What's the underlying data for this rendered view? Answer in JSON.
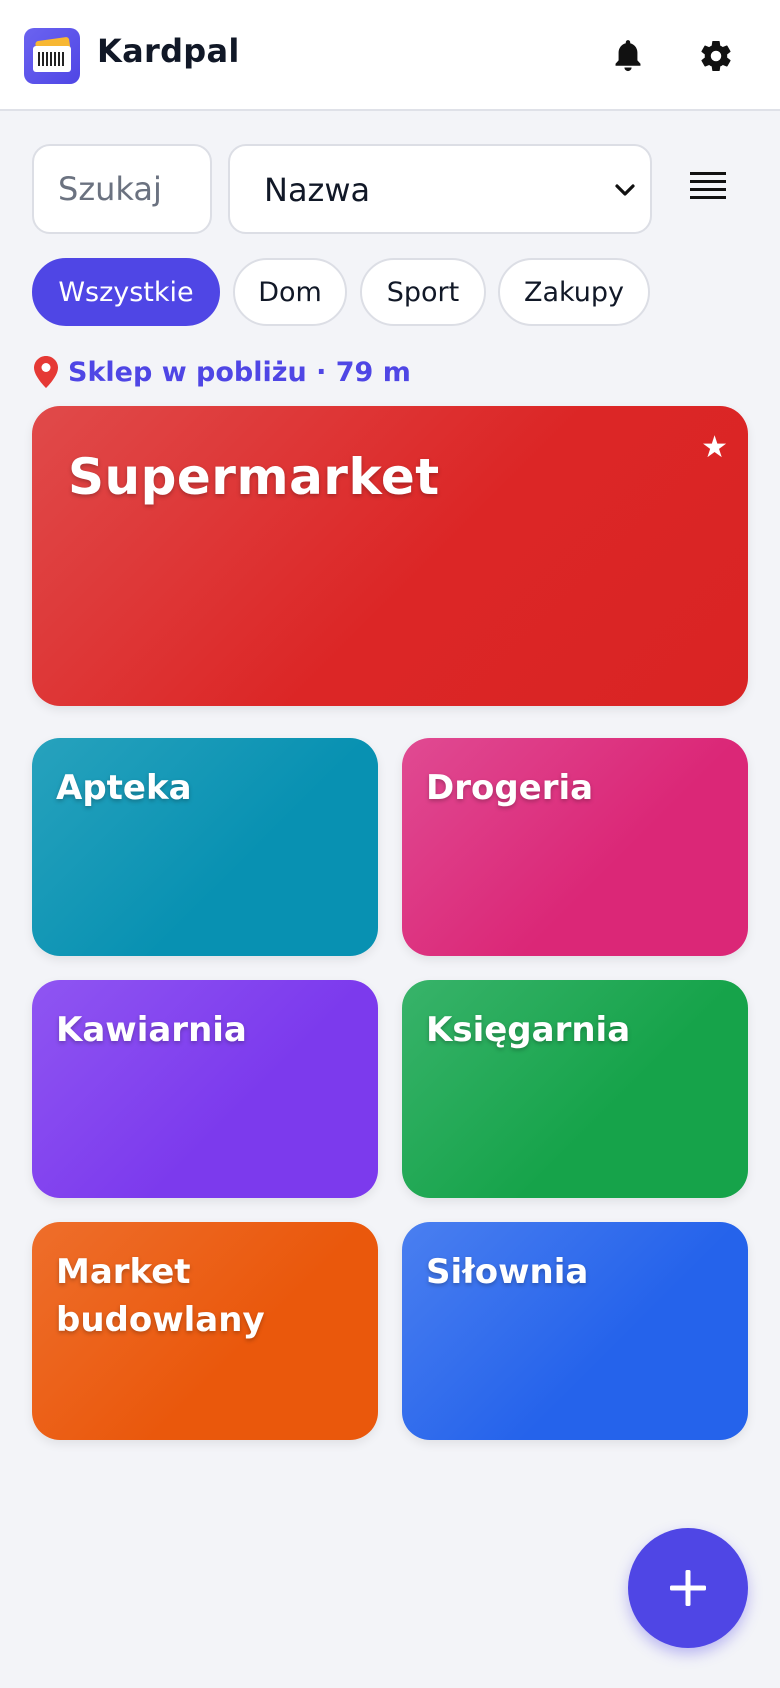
{
  "app": {
    "title": "Kardpal"
  },
  "colors": {
    "accent": "#4f46e5"
  },
  "icons": {
    "logo": "loyalty-card-barcode-icon",
    "notifications": "bell-icon",
    "settings": "gear-icon",
    "view_toggle": "list-view-icon",
    "nearby": "map-pin-icon",
    "favorite": "star-icon",
    "add": "plus-icon"
  },
  "search": {
    "placeholder": "Szukaj",
    "value": ""
  },
  "sort": {
    "selected": "Nazwa"
  },
  "chips": [
    {
      "label": "Wszystkie",
      "active": true
    },
    {
      "label": "Dom",
      "active": false
    },
    {
      "label": "Sport",
      "active": false
    },
    {
      "label": "Zakupy",
      "active": false
    }
  ],
  "nearby": {
    "text": "Sklep w pobliżu · 79 m"
  },
  "featured_card": {
    "name": "Supermarket",
    "color": "#dc2626",
    "favorite": true,
    "favorite_glyph": "★"
  },
  "cards": [
    {
      "name": "Apteka",
      "color": "#0891b2"
    },
    {
      "name": "Drogeria",
      "color": "#db2777"
    },
    {
      "name": "Kawiarnia",
      "color": "#7c3aed"
    },
    {
      "name": "Księgarnia",
      "color": "#16a34a"
    },
    {
      "name": "Market budowlany",
      "color": "#ea580c"
    },
    {
      "name": "Siłownia",
      "color": "#2563eb"
    }
  ]
}
